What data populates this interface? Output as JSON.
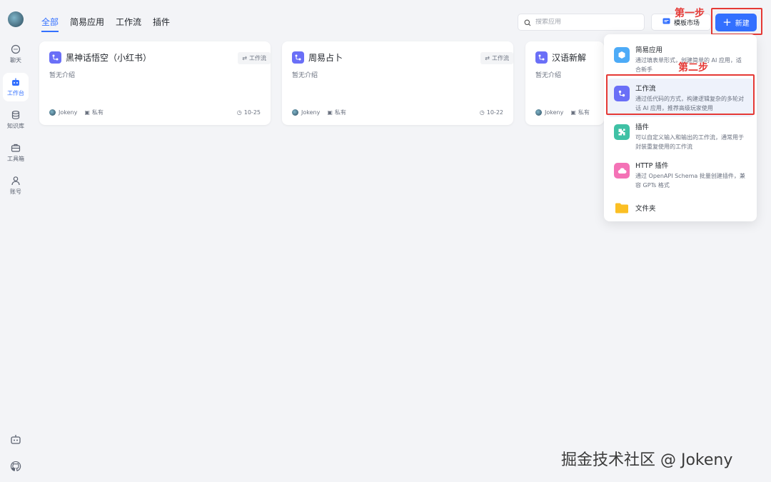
{
  "sidebar": {
    "items": [
      {
        "label": "聊天",
        "icon": "chat-icon",
        "active": false
      },
      {
        "label": "工作台",
        "icon": "robot-icon",
        "active": true
      },
      {
        "label": "知识库",
        "icon": "database-icon",
        "active": false
      },
      {
        "label": "工具箱",
        "icon": "toolbox-icon",
        "active": false
      },
      {
        "label": "账号",
        "icon": "user-icon",
        "active": false
      }
    ],
    "bottom_icons": [
      "bot-icon",
      "github-icon"
    ]
  },
  "tabs": [
    {
      "label": "全部",
      "active": true
    },
    {
      "label": "简易应用",
      "active": false
    },
    {
      "label": "工作流",
      "active": false
    },
    {
      "label": "插件",
      "active": false
    }
  ],
  "search": {
    "placeholder": "搜索应用"
  },
  "template_market": {
    "label": "模板市场"
  },
  "new_button": {
    "label": "新建"
  },
  "annotations": {
    "step1": "第一步",
    "step2": "第二步",
    "color": "#e53935"
  },
  "cards": [
    {
      "title": "黑神话悟空（小红书）",
      "badge": "工作流",
      "intro": "暂无介绍",
      "author": "Jokeny",
      "visibility": "私有",
      "date": "10-25"
    },
    {
      "title": "周易占卜",
      "badge": "工作流",
      "intro": "暂无介绍",
      "author": "Jokeny",
      "visibility": "私有",
      "date": "10-22"
    },
    {
      "title": "汉语新解",
      "badge": "",
      "intro": "暂无介绍",
      "author": "Jokeny",
      "visibility": "私有",
      "date": ""
    }
  ],
  "dropdown": {
    "items": [
      {
        "title": "简易应用",
        "desc": "通过填表单形式，创建简单的 AI 应用，适合新手",
        "icon": "simple-app-icon",
        "color": "#4dabf7"
      },
      {
        "title": "工作流",
        "desc": "通过低代码的方式，构建逻辑复杂的多轮对话 AI 应用，推荐高级玩家使用",
        "icon": "workflow-icon",
        "color": "#6a6ff7"
      },
      {
        "title": "插件",
        "desc": "可以自定义输入和输出的工作流，通常用于封装重复使用的工作流",
        "icon": "plugin-icon",
        "color": "#3fc1a5"
      },
      {
        "title": "HTTP 插件",
        "desc": "通过 OpenAPI Schema 批量创建插件，兼容 GPTs 格式",
        "icon": "cloud-icon",
        "color": "#f472b6"
      },
      {
        "title": "文件夹",
        "desc": "",
        "icon": "folder-icon",
        "color": "#fbbf24"
      }
    ]
  },
  "watermark": "掘金技术社区 @ Jokeny",
  "colors": {
    "accent": "#3370ff",
    "background": "#f3f4f7"
  }
}
